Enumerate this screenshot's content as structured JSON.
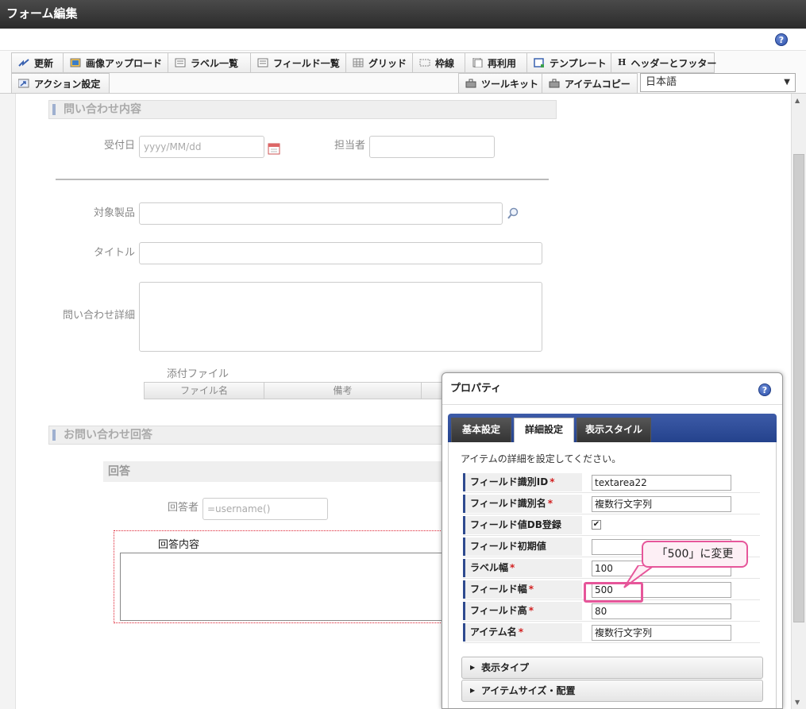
{
  "window": {
    "title": "フォーム編集"
  },
  "toolbar": {
    "row1": [
      {
        "label": "更新",
        "icon": "update-icon"
      },
      {
        "label": "画像アップロード",
        "icon": "image-upload-icon"
      },
      {
        "label": "ラベル一覧",
        "icon": "label-list-icon"
      },
      {
        "label": "フィールド一覧",
        "icon": "field-list-icon"
      },
      {
        "label": "グリッド",
        "icon": "grid-icon"
      },
      {
        "label": "枠線",
        "icon": "border-icon"
      },
      {
        "label": "再利用",
        "icon": "reuse-icon"
      },
      {
        "label": "テンプレート",
        "icon": "template-icon"
      },
      {
        "label": "ヘッダーとフッター",
        "icon": "header-footer-icon"
      }
    ],
    "action_label": "アクション設定",
    "toolkit_label": "ツールキット",
    "item_copy_label": "アイテムコピー",
    "language": "日本語",
    "help": "?"
  },
  "form": {
    "section1_title": "問い合わせ内容",
    "received_date_label": "受付日",
    "received_date_placeholder": "yyyy/MM/dd",
    "assignee_label": "担当者",
    "product_label": "対象製品",
    "title_label": "タイトル",
    "detail_label": "問い合わせ詳細",
    "attachment_label": "添付ファイル",
    "attachment_columns": [
      "ファイル名",
      "備考"
    ],
    "section2_title": "お問い合わせ回答",
    "answer_group_title": "回答",
    "responder_label": "回答者",
    "responder_value": "=username()",
    "answer_content_label": "回答内容"
  },
  "properties": {
    "title": "プロパティ",
    "help": "?",
    "tabs": [
      "基本設定",
      "詳細設定",
      "表示スタイル"
    ],
    "active_tab": "詳細設定",
    "description": "アイテムの詳細を設定してください。",
    "rows": [
      {
        "key": "フィールド識別ID",
        "required": "*",
        "value": "textarea22"
      },
      {
        "key": "フィールド識別名",
        "required": "*",
        "value": "複数行文字列"
      },
      {
        "key": "フィールド値DB登録",
        "required": "",
        "checked": "✔"
      },
      {
        "key": "フィールド初期値",
        "required": "",
        "value": ""
      },
      {
        "key": "ラベル幅",
        "required": "*",
        "value": "100"
      },
      {
        "key": "フィールド幅",
        "required": "*",
        "value": "500"
      },
      {
        "key": "フィールド高",
        "required": "*",
        "value": "80"
      },
      {
        "key": "アイテム名",
        "required": "*",
        "value": "複数行文字列"
      }
    ],
    "accordions": [
      "表示タイプ",
      "アイテムサイズ・配置"
    ]
  },
  "annotation": {
    "callout": "「500」に変更"
  },
  "colors": {
    "accent": "#e6569a",
    "tab_bar": "#2f4b8f"
  }
}
